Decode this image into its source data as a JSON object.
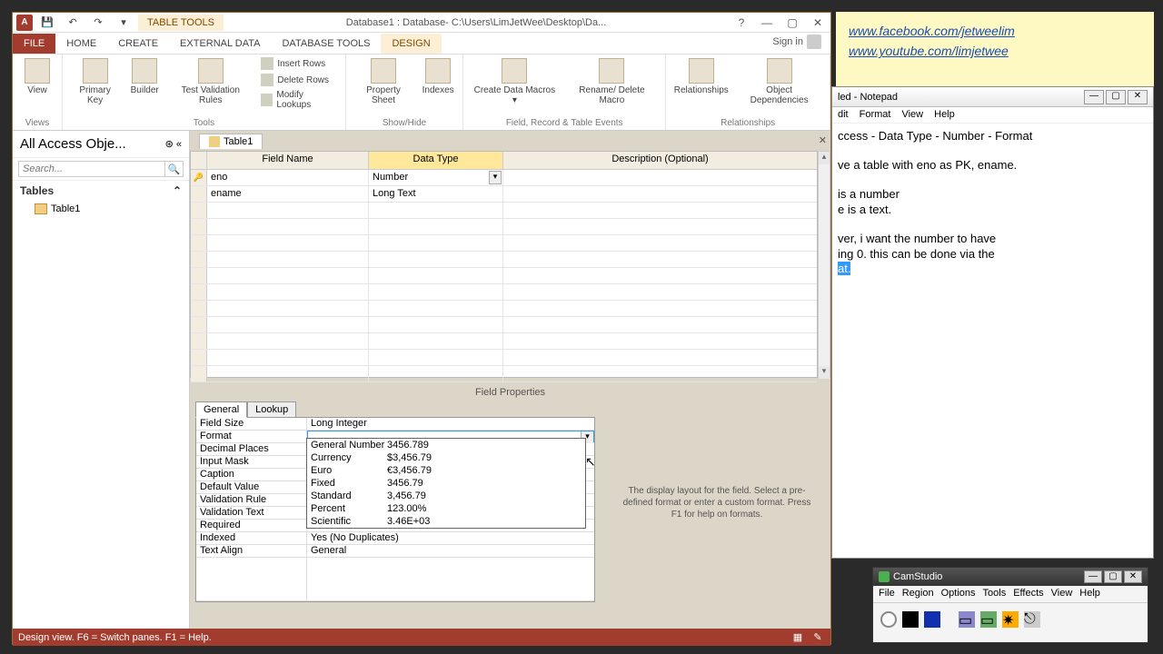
{
  "access": {
    "title": "Database1 : Database- C:\\Users\\LimJetWee\\Desktop\\Da...",
    "tool_tab": "TABLE TOOLS",
    "help_q": "?",
    "tabs": {
      "file": "FILE",
      "home": "HOME",
      "create": "CREATE",
      "external": "EXTERNAL DATA",
      "dbtools": "DATABASE TOOLS",
      "design": "DESIGN"
    },
    "signin": "Sign in",
    "ribbon": {
      "views": {
        "view": "View",
        "label": "Views"
      },
      "tools": {
        "pk": "Primary\nKey",
        "builder": "Builder",
        "test": "Test Validation\nRules",
        "insert": "Insert Rows",
        "delete": "Delete Rows",
        "modify": "Modify Lookups",
        "label": "Tools"
      },
      "showhide": {
        "prop": "Property\nSheet",
        "idx": "Indexes",
        "label": "Show/Hide"
      },
      "events": {
        "macros": "Create Data\nMacros ▾",
        "rename": "Rename/\nDelete Macro",
        "label": "Field, Record & Table Events"
      },
      "rel": {
        "rel": "Relationships",
        "obj": "Object\nDependencies",
        "label": "Relationships"
      }
    },
    "nav": {
      "title": "All Access Obje...",
      "search": "Search...",
      "group": "Tables",
      "item": "Table1"
    },
    "doc_tab": "Table1",
    "grid": {
      "headers": {
        "field": "Field Name",
        "type": "Data Type",
        "desc": "Description (Optional)"
      },
      "rows": [
        {
          "pk": true,
          "name": "eno",
          "type": "Number",
          "selected": true
        },
        {
          "pk": false,
          "name": "ename",
          "type": "Long Text",
          "selected": false
        }
      ]
    },
    "fp_title": "Field Properties",
    "fp_tabs": {
      "general": "General",
      "lookup": "Lookup"
    },
    "fp": {
      "FieldSize": "Long Integer",
      "Format": "",
      "DecimalPlaces": "",
      "InputMask": "",
      "Caption": "",
      "DefaultValue": "",
      "ValidationRule": "",
      "ValidationText": "",
      "Required": "",
      "Indexed": "Yes (No Duplicates)",
      "TextAlign": "General"
    },
    "fp_labels": {
      "FieldSize": "Field Size",
      "Format": "Format",
      "DecimalPlaces": "Decimal Places",
      "InputMask": "Input Mask",
      "Caption": "Caption",
      "DefaultValue": "Default Value",
      "ValidationRule": "Validation Rule",
      "ValidationText": "Validation Text",
      "Required": "Required",
      "Indexed": "Indexed",
      "TextAlign": "Text Align"
    },
    "format_options": [
      {
        "name": "General Number",
        "ex": "3456.789"
      },
      {
        "name": "Currency",
        "ex": "$3,456.79"
      },
      {
        "name": "Euro",
        "ex": "€3,456.79"
      },
      {
        "name": "Fixed",
        "ex": "3456.79"
      },
      {
        "name": "Standard",
        "ex": "3,456.79"
      },
      {
        "name": "Percent",
        "ex": "123.00%"
      },
      {
        "name": "Scientific",
        "ex": "3.46E+03"
      }
    ],
    "fp_help": "The display layout for the field. Select a pre-defined format or enter a custom format. Press F1 for help on formats.",
    "status": "Design view.   F6 = Switch panes.   F1 = Help."
  },
  "sticky": {
    "link1": "www.facebook.com/jetweelim",
    "link2": "www.youtube.com/limjetwee"
  },
  "notepad": {
    "title": "led - Notepad",
    "menu": [
      "dit",
      "Format",
      "View",
      "Help"
    ],
    "line1": "ccess - Data Type - Number - Format",
    "line2": "ve a table with eno as PK, ename.",
    "line3": "is a number",
    "line4": "e is a text.",
    "line5": "ver, i want the number to have",
    "line6": "ing 0. this can be done via the",
    "line7": "at."
  },
  "cam": {
    "title": "CamStudio",
    "menu": [
      "File",
      "Region",
      "Options",
      "Tools",
      "Effects",
      "View",
      "Help"
    ]
  }
}
